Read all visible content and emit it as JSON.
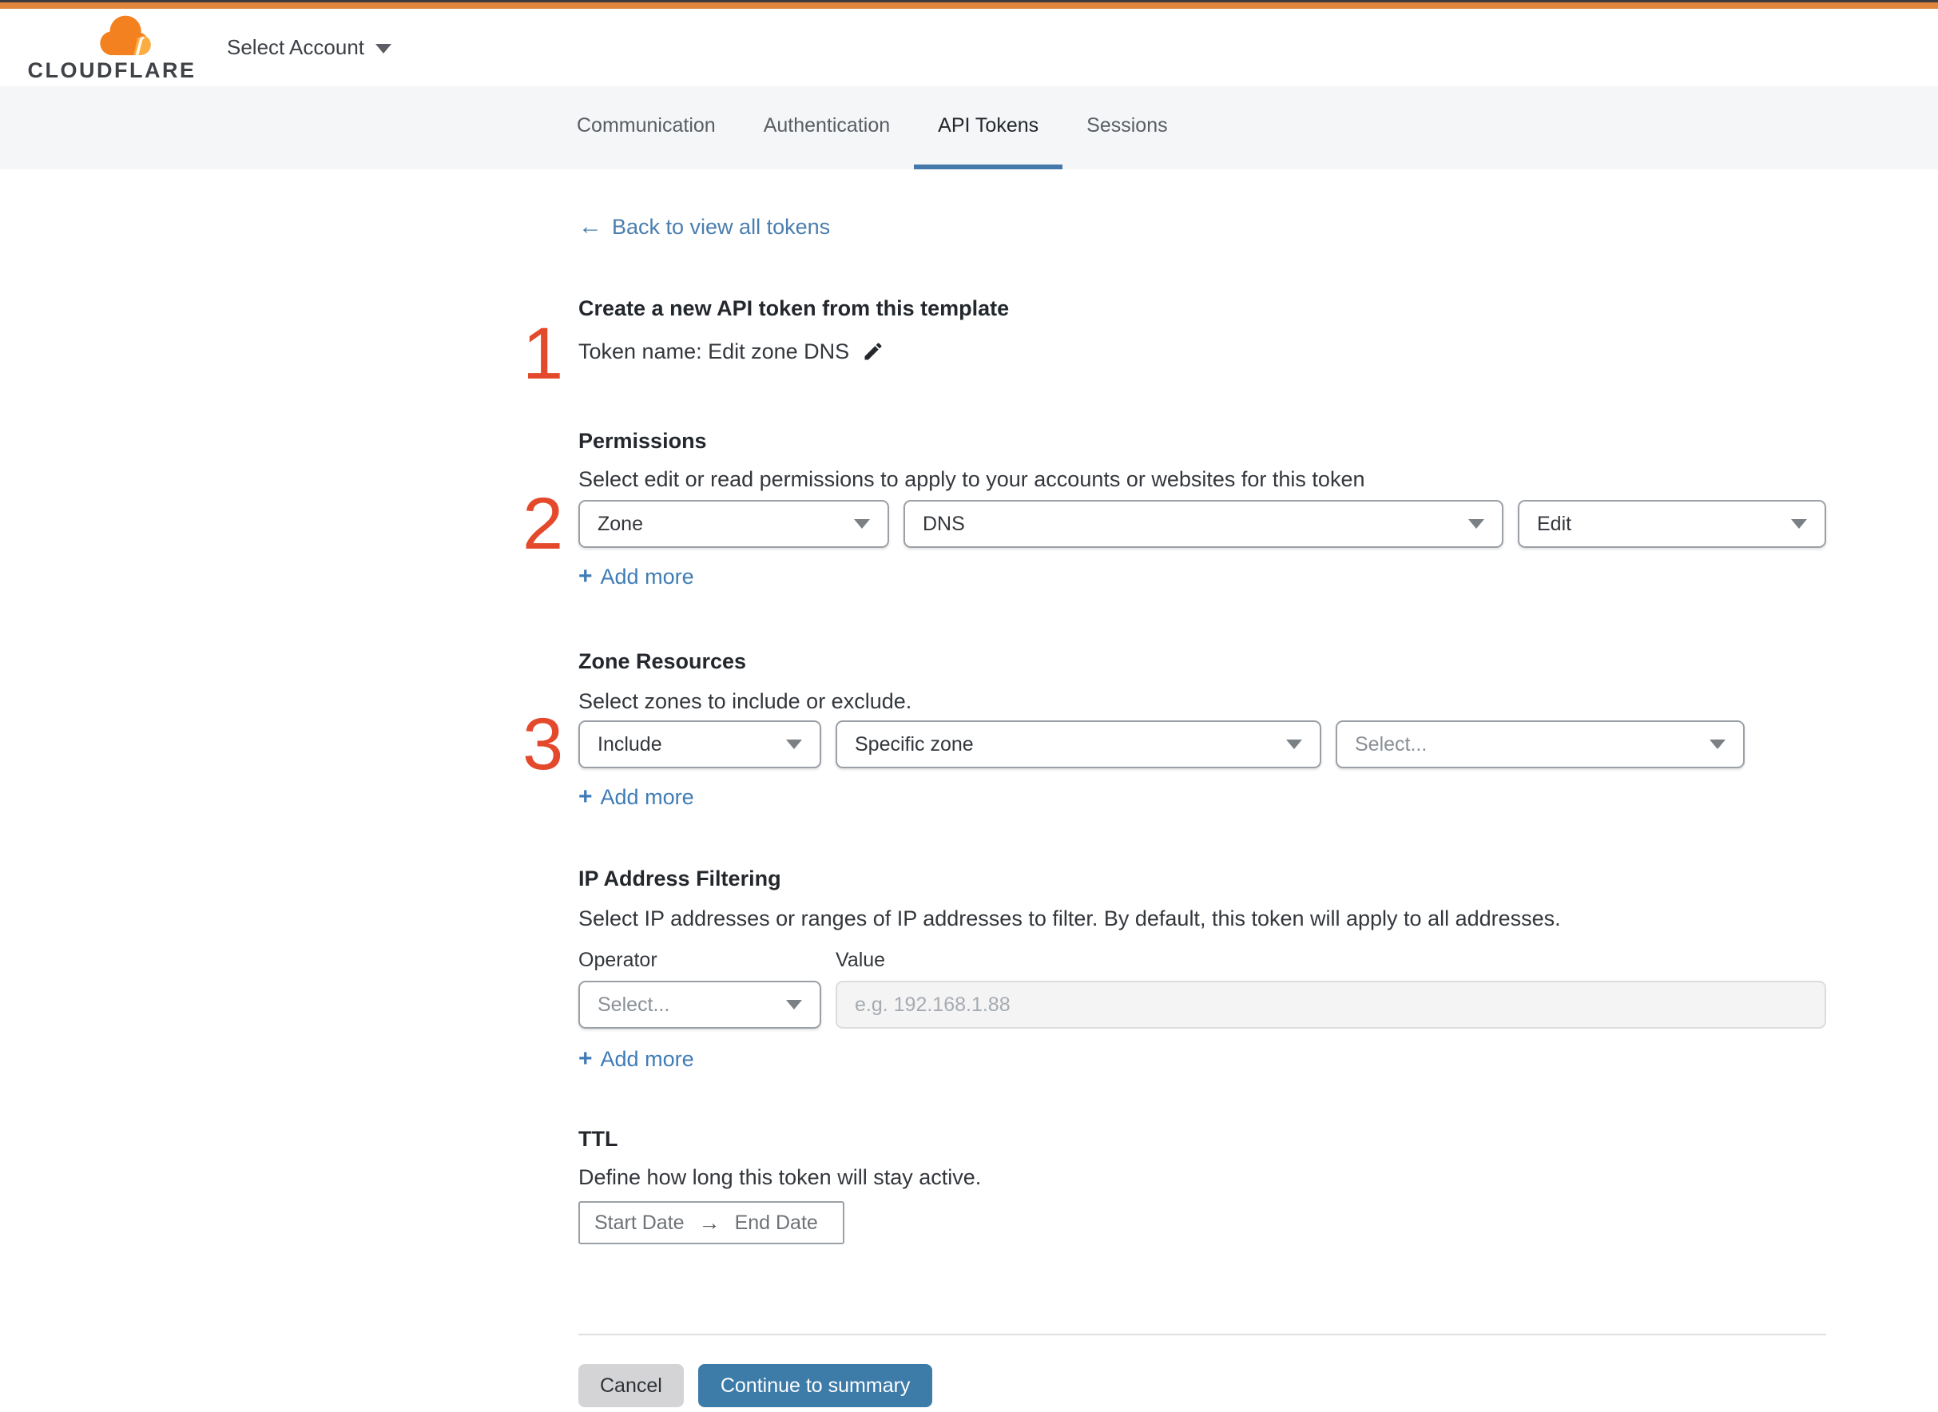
{
  "ui": {
    "plus": "+",
    "back_arrow": "←",
    "range_arrow": "→"
  },
  "colors": {
    "top_bar_orange": "#e0873d",
    "brand_orange": "#f48120",
    "brand_orange_light": "#fbad41",
    "link_blue": "#3f7cb6",
    "tab_underline_blue": "#4579ab",
    "button_blue": "#3d7ba9",
    "step_red": "#e4492c"
  },
  "header": {
    "brand": "CLOUDFLARE",
    "account_selector": "Select Account"
  },
  "tabs": {
    "active": "API Tokens",
    "items": [
      {
        "label": "Communication"
      },
      {
        "label": "Authentication"
      },
      {
        "label": "API Tokens"
      },
      {
        "label": "Sessions"
      }
    ]
  },
  "back_link": {
    "label": "Back to view all tokens"
  },
  "token_section": {
    "step": "1",
    "heading": "Create a new API token from this template",
    "token_name": "Token name: Edit zone DNS"
  },
  "permissions": {
    "step": "2",
    "heading": "Permissions",
    "description": "Select edit or read permissions to apply to your accounts or websites for this token",
    "scope": "Zone",
    "resource": "DNS",
    "access": "Edit",
    "add_more": "Add more"
  },
  "zone_resources": {
    "step": "3",
    "heading": "Zone Resources",
    "description": "Select zones to include or exclude.",
    "mode": "Include",
    "type": "Specific zone",
    "zone_placeholder": "Select...",
    "add_more": "Add more"
  },
  "ip_filtering": {
    "heading": "IP Address Filtering",
    "description": "Select IP addresses or ranges of IP addresses to filter. By default, this token will apply to all addresses.",
    "operator_label": "Operator",
    "value_label": "Value",
    "operator_value": "Select...",
    "value_placeholder": "e.g. 192.168.1.88",
    "add_more": "Add more"
  },
  "ttl": {
    "heading": "TTL",
    "description": "Define how long this token will stay active.",
    "start_label": "Start Date",
    "end_label": "End Date"
  },
  "footer": {
    "cancel": "Cancel",
    "continue": "Continue to summary"
  }
}
